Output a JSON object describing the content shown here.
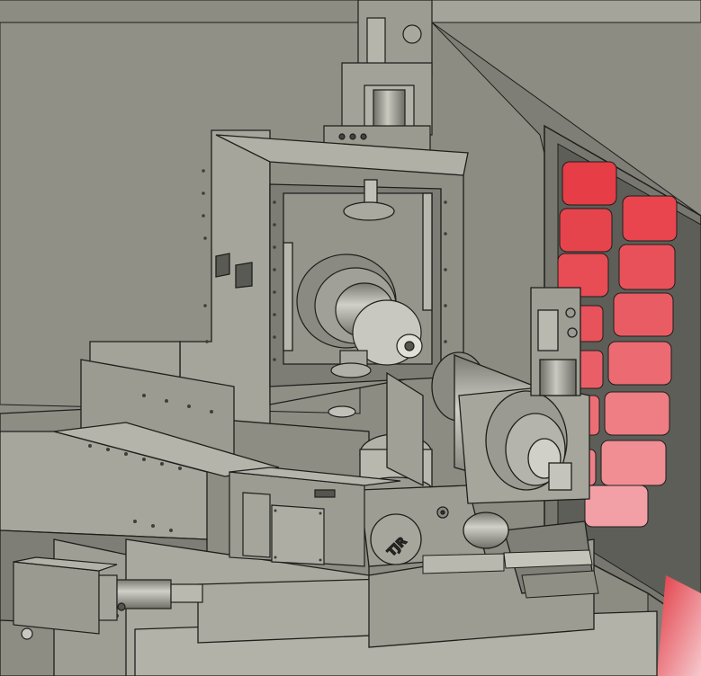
{
  "scene": {
    "logo_text": "TJR",
    "colors": {
      "body": "#9a9a90",
      "body_dark": "#6e6e66",
      "body_light": "#b8b8ae",
      "outline": "#1e1e1c",
      "window_red": "#e8414a",
      "window_pink": "#f3b7bd",
      "background": "#8a8a80"
    }
  }
}
